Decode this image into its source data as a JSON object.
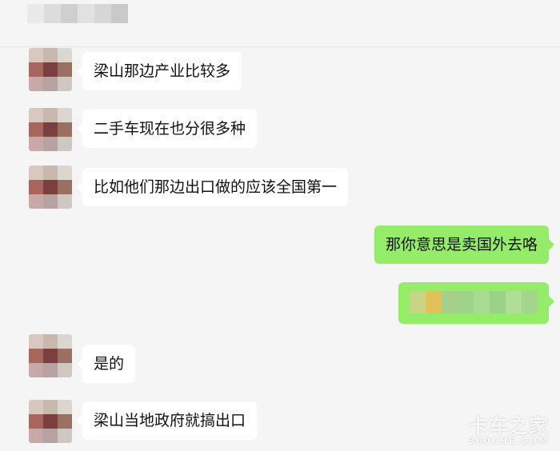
{
  "chat": {
    "messages": [
      {
        "side": "in",
        "text": "梁山那边产业比较多"
      },
      {
        "side": "in",
        "text": "二手车现在也分很多种"
      },
      {
        "side": "in",
        "text": "比如他们那边出口做的应该全国第一"
      },
      {
        "side": "out",
        "text": "那你意思是卖国外去咯"
      },
      {
        "side": "out",
        "content": "blurred-image"
      },
      {
        "side": "in",
        "text": "是的"
      },
      {
        "side": "in",
        "text": "梁山当地政府就搞出口"
      }
    ]
  },
  "watermark": {
    "brand": "卡车之家",
    "domain": "360CHE.COM"
  },
  "colors": {
    "background": "#f5f5f5",
    "incoming_bubble": "#ffffff",
    "outgoing_bubble": "#95ec69"
  }
}
